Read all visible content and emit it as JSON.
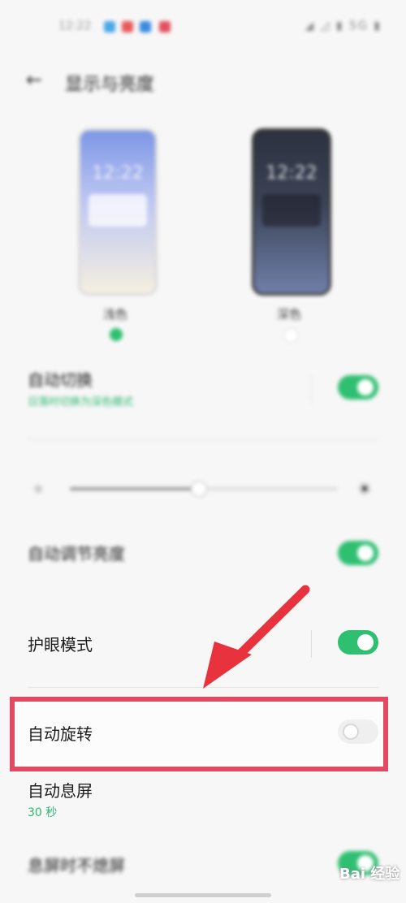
{
  "status_bar": {
    "time": "12:22",
    "right": "◢ ◿ ▮ 5G ▮"
  },
  "header": {
    "back_icon": "←",
    "title": "显示与亮度"
  },
  "theme": {
    "light": {
      "label": "浅色",
      "preview_time": "12:22"
    },
    "dark": {
      "label": "深色",
      "preview_time": "12:22"
    }
  },
  "rows": {
    "auto_switch": {
      "title": "自动切换",
      "subtitle": "日落时切换为深色模式"
    },
    "auto_brightness": {
      "title": "自动调节亮度"
    },
    "eye_care": {
      "title": "护眼模式"
    },
    "auto_rotate": {
      "title": "自动旋转"
    },
    "screen_timeout": {
      "title": "自动息屏",
      "subtitle": "30 秒"
    },
    "bottom": {
      "title": "息屏时不熄屏"
    }
  },
  "brightness": {
    "level": 0.48
  },
  "annotation": {
    "color": "#e24a63"
  },
  "watermark": "Bai 经验",
  "colors": {
    "accent": "#2fbf71",
    "highlight": "#e24a63"
  }
}
